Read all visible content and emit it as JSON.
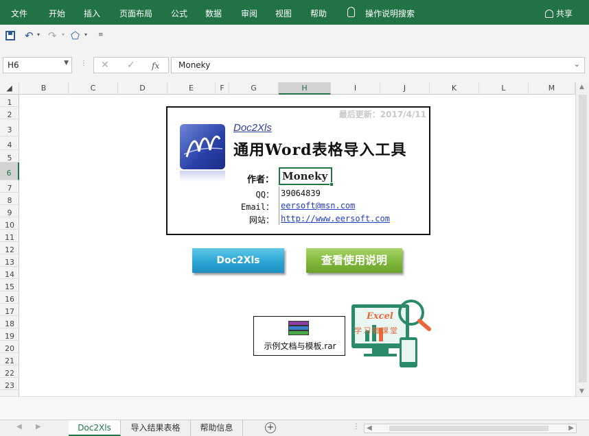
{
  "ribbon": {
    "tabs": [
      "文件",
      "开始",
      "插入",
      "页面布局",
      "公式",
      "数据",
      "审阅",
      "视图",
      "帮助"
    ],
    "search_label": "操作说明搜索",
    "share_label": "共享"
  },
  "formula_bar": {
    "name_box": "H6",
    "fx_label": "fx",
    "formula_value": "Moneky"
  },
  "columns": [
    "B",
    "C",
    "D",
    "E",
    "F",
    "G",
    "H",
    "I",
    "J",
    "K",
    "L",
    "M"
  ],
  "rows": [
    "1",
    "2",
    "3",
    "4",
    "5",
    "6",
    "7",
    "8",
    "9",
    "10",
    "11",
    "12",
    "13",
    "14",
    "15",
    "16",
    "17",
    "18",
    "19",
    "20",
    "21",
    "22",
    "23"
  ],
  "selected_cell": {
    "column": "H",
    "row": "6"
  },
  "card": {
    "updated": "最后更新：2017/4/11",
    "app_name": "Doc2Xls",
    "app_title": "通用Word表格导入工具",
    "author_label": "作者：",
    "author_value": "Moneky",
    "qq_label": "QQ：",
    "qq_value": "39064839",
    "email_label": "Email：",
    "email_value": "eersoft@msn.com",
    "site_label": "网站：",
    "site_value": "http://www.eersoft.com"
  },
  "buttons": {
    "doc2xls": "Doc2Xls",
    "help": "查看使用说明"
  },
  "attachment": {
    "filename": "示例文档与模板.rar"
  },
  "illustration": {
    "title": "Excel",
    "subtitle": "学习微课堂"
  },
  "sheet_tabs": [
    "Doc2Xls",
    "导入结果表格",
    "帮助信息"
  ],
  "colors": {
    "excel_green": "#217346",
    "link_blue": "#1f3ec8",
    "button_blue": "#2aa5d3",
    "button_green": "#7fb83a"
  }
}
